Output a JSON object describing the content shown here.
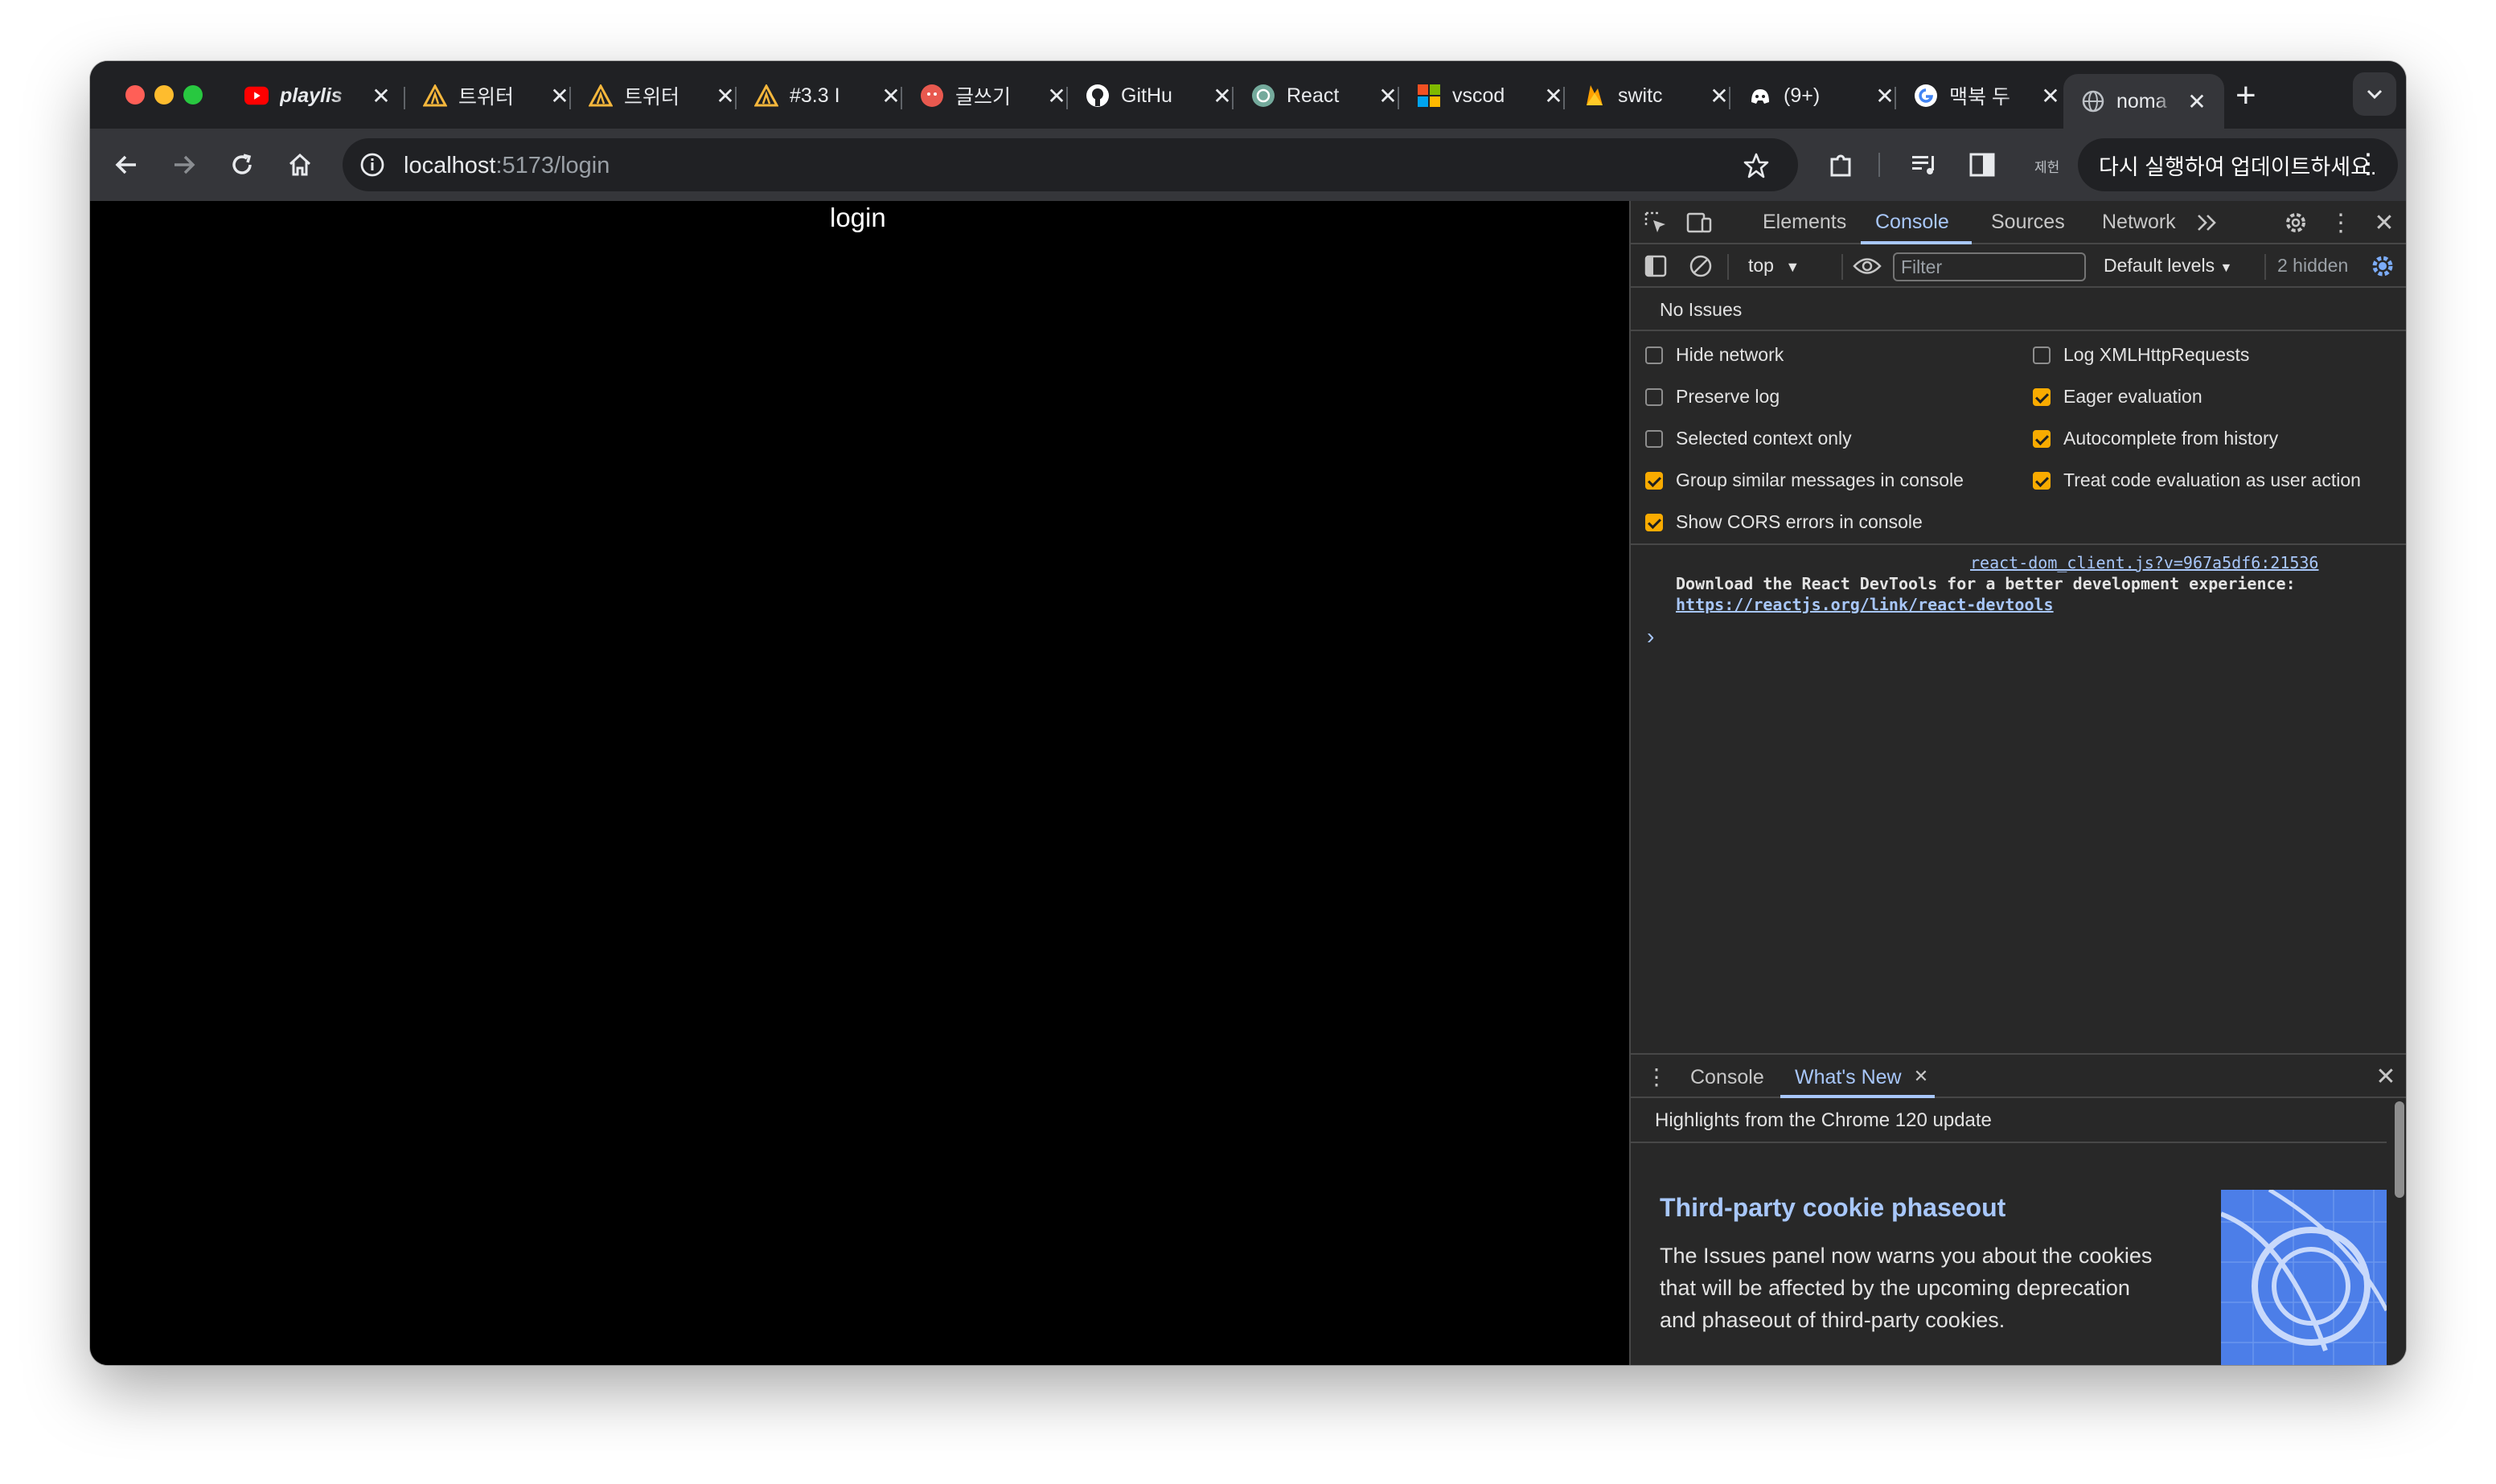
{
  "tabs": [
    {
      "title": "playlis",
      "icon": "youtube-icon",
      "italic": true
    },
    {
      "title": "트위터",
      "icon": "warning-triangle-icon"
    },
    {
      "title": "트위터",
      "icon": "warning-triangle-icon"
    },
    {
      "title": "#3.3 I",
      "icon": "warning-triangle-icon"
    },
    {
      "title": "글쓰기",
      "icon": "velog-icon"
    },
    {
      "title": "GitHu",
      "icon": "github-icon"
    },
    {
      "title": "React",
      "icon": "chatgpt-icon"
    },
    {
      "title": "vscod",
      "icon": "microsoft-icon"
    },
    {
      "title": "switc",
      "icon": "firebase-icon"
    },
    {
      "title": "(9+)",
      "icon": "discord-icon"
    },
    {
      "title": "맥북 두",
      "icon": "google-icon"
    },
    {
      "title": "noma",
      "icon": "globe-icon",
      "active": true
    }
  ],
  "toolbar": {
    "url_host": "localhost",
    "url_path": ":5173/login",
    "profile_label": "제헌",
    "update_label": "다시 실행하여 업데이트하세요."
  },
  "page": {
    "heading": "login"
  },
  "devtools": {
    "tabs": [
      "Elements",
      "Console",
      "Sources",
      "Network"
    ],
    "active_tab": "Console",
    "context": "top",
    "filter_placeholder": "Filter",
    "levels": "Default levels",
    "hidden_count": "2 hidden",
    "issues": "No Issues",
    "settings": [
      {
        "label": "Hide network",
        "checked": false
      },
      {
        "label": "Log XMLHttpRequests",
        "checked": false
      },
      {
        "label": "Preserve log",
        "checked": false
      },
      {
        "label": "Eager evaluation",
        "checked": true
      },
      {
        "label": "Selected context only",
        "checked": false
      },
      {
        "label": "Autocomplete from history",
        "checked": true
      },
      {
        "label": "Group similar messages in console",
        "checked": true
      },
      {
        "label": "Treat code evaluation as user action",
        "checked": true
      },
      {
        "label": "Show CORS errors in console",
        "checked": true
      }
    ],
    "message": {
      "source": "react-dom_client.js?v=967a5df6:21536",
      "text": "Download the React DevTools for a better development experience:",
      "link": "https://reactjs.org/link/react-devtools"
    },
    "prompt": "›",
    "drawer": {
      "tabs": [
        "Console",
        "What's New"
      ],
      "active_tab": "What's New",
      "highlights": "Highlights from the Chrome 120 update",
      "article_title": "Third-party cookie phaseout",
      "article_body": "The Issues panel now warns you about the cookies that will be affected by the upcoming deprecation and phaseout of third-party cookies."
    }
  },
  "colors": {
    "accent": "#a8c7fa",
    "checkbox_on": "#f9ab00",
    "page_bg": "#000000"
  }
}
